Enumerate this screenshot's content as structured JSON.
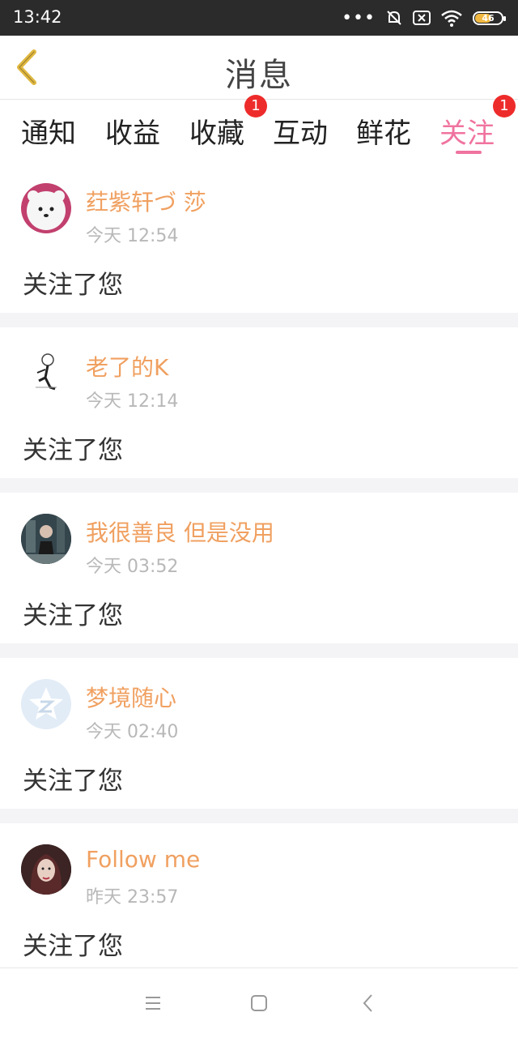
{
  "status_bar": {
    "time": "13:42",
    "battery": "46"
  },
  "header": {
    "title": "消息"
  },
  "tabs": [
    {
      "label": "通知"
    },
    {
      "label": "收益"
    },
    {
      "label": "收藏",
      "badge": "1"
    },
    {
      "label": "互动"
    },
    {
      "label": "鲜花"
    },
    {
      "label": "关注",
      "badge": "1",
      "active": true
    }
  ],
  "feed": [
    {
      "name": "荭紫轩づ 莎",
      "time": "今天 12:54",
      "message": "关注了您"
    },
    {
      "name": "老了的K",
      "time": "今天 12:14",
      "message": "关注了您"
    },
    {
      "name": "我很善良 但是没用",
      "time": "今天 03:52",
      "message": "关注了您"
    },
    {
      "name": "梦境随心",
      "time": "今天 02:40",
      "message": "关注了您"
    },
    {
      "name": "Follow me",
      "time": "昨天 23:57",
      "message": "关注了您"
    }
  ],
  "colors": {
    "accent": "#f0739f",
    "username": "#f0a060",
    "badge": "#ee2b2b",
    "back_arrow": "#e0b840"
  }
}
